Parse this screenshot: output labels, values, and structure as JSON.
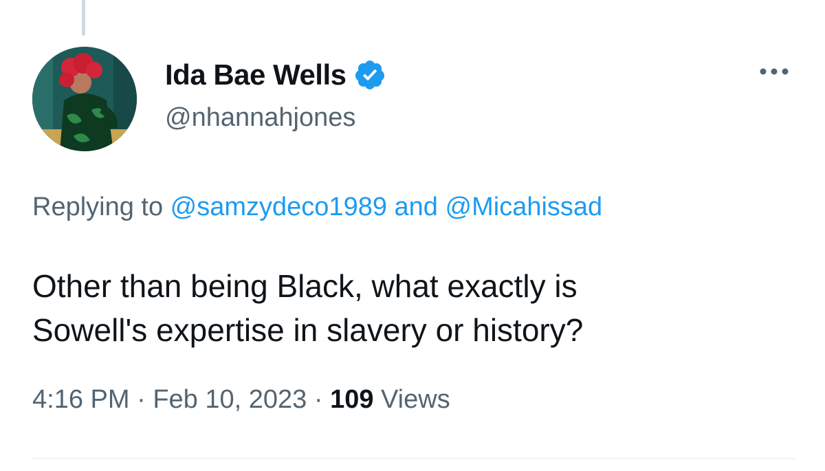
{
  "tweet": {
    "author": {
      "display_name": "Ida Bae Wells",
      "handle": "@nhannahjones",
      "verified": true,
      "avatar_icon": "profile-photo"
    },
    "more_icon": "more-horizontal-icon",
    "reply_context": {
      "prefix": "Replying to ",
      "mention_1": "@samzydeco1989",
      "joiner": " and ",
      "mention_2": "@Micahissad"
    },
    "text_line_1": "Other than being Black, what exactly is",
    "text_line_2": "Sowell's expertise in slavery or history?",
    "meta": {
      "time": "4:16 PM",
      "separator": " · ",
      "date": "Feb 10, 2023",
      "views_count": "109",
      "views_label": " Views"
    }
  },
  "colors": {
    "text_primary": "#0f1419",
    "text_secondary": "#536471",
    "link": "#1d9bf0",
    "verified_badge": "#1d9bf0"
  }
}
